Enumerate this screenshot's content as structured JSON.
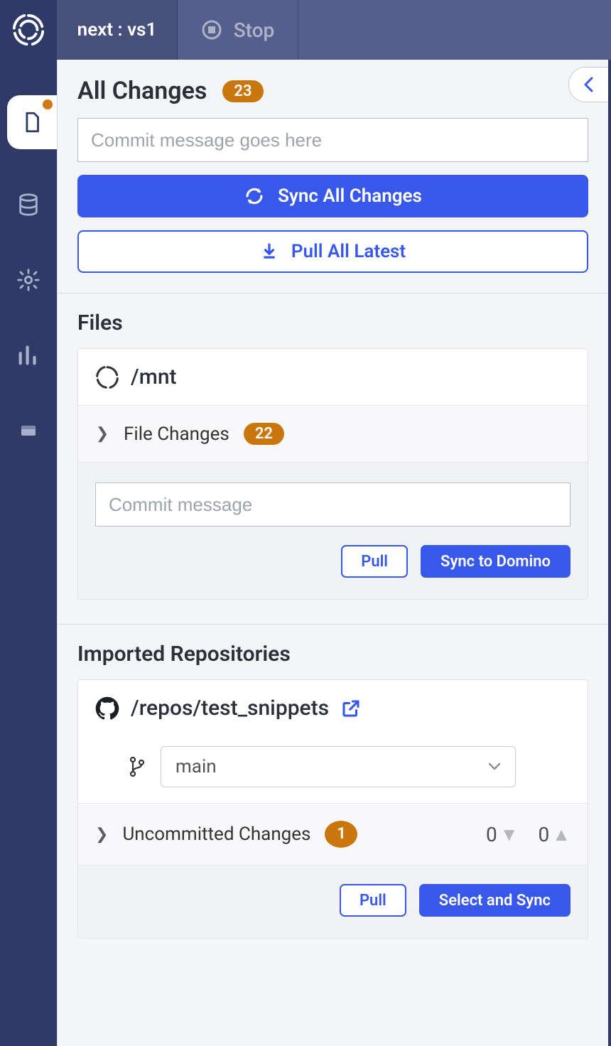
{
  "header": {
    "workspace_label": "next : vs1",
    "stop_label": "Stop"
  },
  "all_changes": {
    "title": "All Changes",
    "count": "23",
    "commit_placeholder": "Commit message goes here",
    "sync_label": "Sync All Changes",
    "pull_label": "Pull All Latest"
  },
  "files": {
    "title": "Files",
    "mount_path": "/mnt",
    "file_changes_label": "File Changes",
    "file_changes_count": "22",
    "commit_placeholder": "Commit message",
    "pull_label": "Pull",
    "sync_label": "Sync to Domino"
  },
  "repos": {
    "title": "Imported Repositories",
    "repo_path": "/repos/test_snippets",
    "branch_selected": "main",
    "uncommitted_label": "Uncommitted Changes",
    "uncommitted_count": "1",
    "behind_count": "0",
    "ahead_count": "0",
    "pull_label": "Pull",
    "sync_label": "Select and Sync"
  }
}
